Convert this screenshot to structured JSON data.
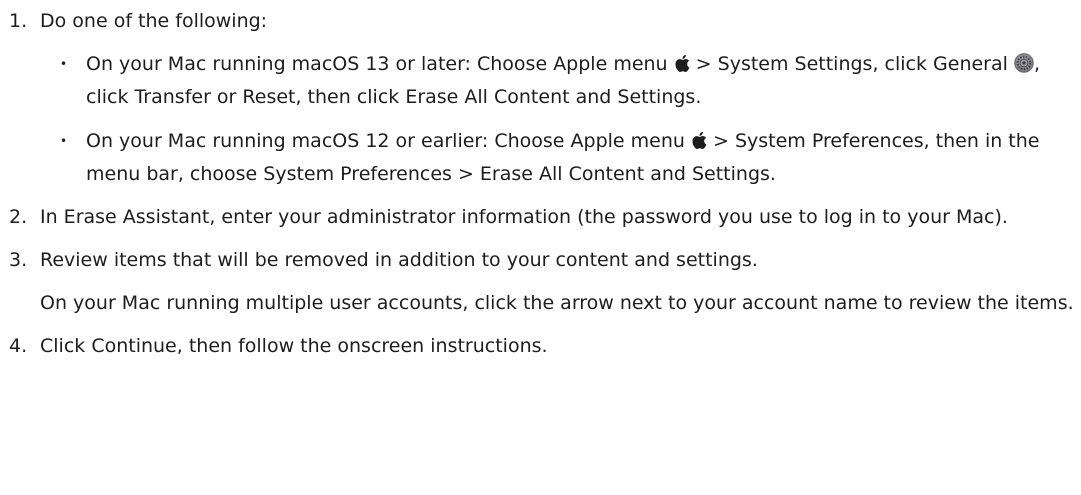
{
  "steps": [
    {
      "number": "1.",
      "text": "Do one of the following:",
      "bullets": [
        {
          "part1": "On your Mac running macOS 13 or later: Choose Apple menu ",
          "part2": " > System Settings, click General ",
          "part3": ", click Transfer or Reset, then click Erase All Content and Settings."
        },
        {
          "part1": "On your Mac running macOS 12 or earlier: Choose Apple menu ",
          "part2": " > System Preferences, then in the menu bar, choose System Preferences > Erase All Content and Settings."
        }
      ]
    },
    {
      "number": "2.",
      "text": "In Erase Assistant, enter your administrator information (the password you use to log in to your Mac)."
    },
    {
      "number": "3.",
      "text": "Review items that will be removed in addition to your content and settings.",
      "followup": "On your Mac running multiple user accounts, click the arrow next to your account name to review the items."
    },
    {
      "number": "4.",
      "text": "Click Continue, then follow the onscreen instructions."
    }
  ],
  "bullet_symbol": "•",
  "icons": {
    "apple": "apple-logo-icon",
    "general": "general-settings-gear-icon"
  }
}
